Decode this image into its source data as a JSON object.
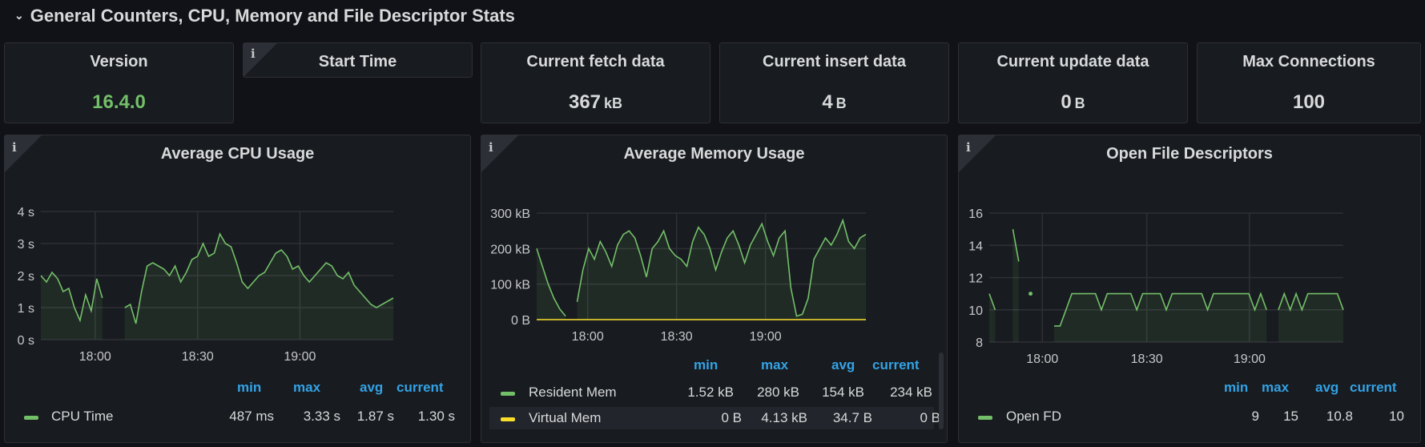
{
  "row": {
    "title": "General Counters, CPU, Memory and File Descriptor Stats"
  },
  "stats": [
    {
      "title": "Version",
      "value": "16.4.0",
      "unit": ""
    },
    {
      "title": "Start Time",
      "value": "",
      "unit": ""
    },
    {
      "title": "Current fetch data",
      "value": "367",
      "unit": "kB"
    },
    {
      "title": "Current insert data",
      "value": "4",
      "unit": "B"
    },
    {
      "title": "Current update data",
      "value": "0",
      "unit": "B"
    },
    {
      "title": "Max Connections",
      "value": "100",
      "unit": ""
    }
  ],
  "info_icon": "i",
  "colors": {
    "green": "#73bf69",
    "yellow": "#fade2a",
    "blue": "#33a2e5",
    "bg": "#181b1f"
  },
  "legend_headers": {
    "min": "min",
    "max": "max",
    "avg": "avg",
    "current": "current"
  },
  "cpu": {
    "title": "Average CPU Usage",
    "legend": [
      {
        "name": "CPU Time",
        "min": "487 ms",
        "max": "3.33 s",
        "avg": "1.87 s",
        "current": "1.30 s"
      }
    ]
  },
  "mem": {
    "title": "Average Memory Usage",
    "legend": [
      {
        "name": "Resident Mem",
        "min": "1.52 kB",
        "max": "280 kB",
        "avg": "154 kB",
        "current": "234 kB"
      },
      {
        "name": "Virtual Mem",
        "min": "0 B",
        "max": "4.13 kB",
        "avg": "34.7 B",
        "current": "0 B"
      }
    ]
  },
  "fd": {
    "title": "Open File Descriptors",
    "legend": [
      {
        "name": "Open FD",
        "min": "9",
        "max": "15",
        "avg": "10.8",
        "current": "10"
      }
    ]
  },
  "chart_data": [
    {
      "type": "area",
      "title": "Average CPU Usage",
      "x_ticks": [
        "18:00",
        "18:30",
        "19:00"
      ],
      "y_ticks": [
        "0 s",
        "1 s",
        "2 s",
        "3 s",
        "4 s"
      ],
      "ylim": [
        0,
        4
      ],
      "series": [
        {
          "name": "CPU Time",
          "color": "#73bf69",
          "values": [
            2.0,
            1.8,
            2.1,
            1.9,
            1.5,
            1.6,
            1.0,
            0.6,
            1.4,
            0.9,
            1.9,
            1.3,
            null,
            null,
            null,
            1.0,
            1.1,
            0.5,
            1.5,
            2.3,
            2.4,
            2.3,
            2.2,
            2.0,
            2.3,
            1.8,
            2.1,
            2.5,
            2.6,
            3.0,
            2.6,
            2.7,
            3.3,
            3.0,
            2.9,
            2.4,
            1.8,
            1.6,
            1.8,
            2.0,
            2.1,
            2.4,
            2.7,
            2.8,
            2.6,
            2.2,
            2.3,
            2.0,
            1.8,
            2.0,
            2.2,
            2.4,
            2.3,
            2.0,
            1.9,
            2.1,
            1.7,
            1.5,
            1.3,
            1.1,
            1.0,
            1.1,
            1.2,
            1.3
          ]
        }
      ],
      "grid": true
    },
    {
      "type": "area",
      "title": "Average Memory Usage",
      "x_ticks": [
        "18:00",
        "18:30",
        "19:00"
      ],
      "y_ticks": [
        "0 B",
        "100 kB",
        "200 kB",
        "300 kB"
      ],
      "ylim": [
        0,
        300
      ],
      "series": [
        {
          "name": "Resident Mem",
          "color": "#73bf69",
          "values": [
            200,
            150,
            100,
            60,
            30,
            10,
            null,
            50,
            140,
            200,
            170,
            220,
            190,
            150,
            210,
            240,
            250,
            230,
            180,
            120,
            200,
            220,
            250,
            200,
            180,
            170,
            150,
            220,
            260,
            240,
            200,
            140,
            190,
            230,
            250,
            210,
            160,
            210,
            240,
            270,
            220,
            180,
            230,
            250,
            90,
            10,
            15,
            60,
            170,
            200,
            230,
            210,
            240,
            280,
            220,
            200,
            230,
            240
          ]
        },
        {
          "name": "Virtual Mem",
          "color": "#fade2a",
          "values": [
            0,
            0,
            0,
            0,
            0,
            0,
            0,
            0,
            0,
            0,
            0,
            0,
            0,
            0,
            0,
            0,
            0,
            0,
            0,
            0,
            0,
            0,
            0,
            0,
            0,
            0,
            0,
            0,
            0,
            0
          ]
        }
      ],
      "grid": true
    },
    {
      "type": "area",
      "title": "Open File Descriptors",
      "x_ticks": [
        "18:00",
        "18:30",
        "19:00"
      ],
      "y_ticks": [
        "8",
        "10",
        "12",
        "14",
        "16"
      ],
      "ylim": [
        8,
        16
      ],
      "series": [
        {
          "name": "Open FD",
          "color": "#73bf69",
          "values": [
            11,
            10,
            null,
            null,
            15,
            13,
            null,
            11,
            null,
            null,
            null,
            9,
            9,
            10,
            11,
            11,
            11,
            11,
            11,
            10,
            11,
            11,
            11,
            11,
            11,
            10,
            11,
            11,
            11,
            11,
            10,
            11,
            11,
            11,
            11,
            11,
            11,
            10,
            11,
            11,
            11,
            11,
            11,
            11,
            11,
            10,
            11,
            10,
            null,
            10,
            11,
            10,
            11,
            10,
            11,
            11,
            11,
            11,
            11,
            11,
            10
          ]
        }
      ],
      "grid": true
    }
  ]
}
